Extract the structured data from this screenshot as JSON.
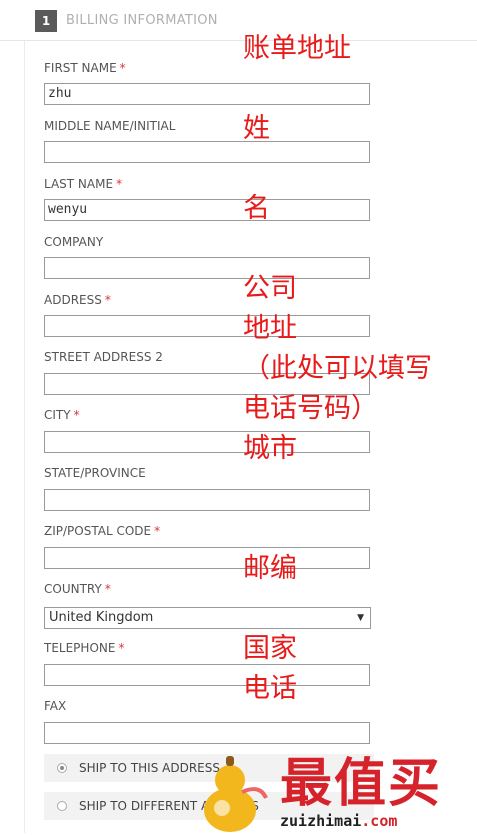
{
  "section": {
    "number": "1",
    "title": "BILLING INFORMATION"
  },
  "fields": {
    "first_name": {
      "label": "FIRST NAME",
      "required": "*",
      "value": "zhu"
    },
    "middle_name": {
      "label": "MIDDLE NAME/INITIAL",
      "value": ""
    },
    "last_name": {
      "label": "LAST NAME",
      "required": "*",
      "value": "wenyu"
    },
    "company": {
      "label": "COMPANY",
      "value": ""
    },
    "address": {
      "label": "ADDRESS",
      "required": "*",
      "value": ""
    },
    "street2": {
      "label": "STREET ADDRESS 2",
      "value": ""
    },
    "city": {
      "label": "CITY",
      "required": "*",
      "value": ""
    },
    "state": {
      "label": "STATE/PROVINCE",
      "value": ""
    },
    "zip": {
      "label": "ZIP/POSTAL CODE",
      "required": "*",
      "value": ""
    },
    "country": {
      "label": "COUNTRY",
      "required": "*",
      "value": "United Kingdom"
    },
    "telephone": {
      "label": "TELEPHONE",
      "required": "*",
      "value": ""
    },
    "fax": {
      "label": "FAX",
      "value": ""
    }
  },
  "shipping_options": [
    {
      "label": "SHIP TO THIS ADDRESS",
      "checked": true
    },
    {
      "label": "SHIP TO DIFFERENT ADDRESS",
      "checked": false
    }
  ],
  "annotations": {
    "billing": "账单地址",
    "first_name": "姓",
    "last_name": "名",
    "company": "公司",
    "address": "地址",
    "street2_line1": "（此处可以填写",
    "street2_line2": "电话号码）",
    "city": "城市",
    "zip": "邮编",
    "country": "国家",
    "telephone": "电话"
  },
  "watermark": {
    "brand": "最值买",
    "url_prefix": "zuizhimai",
    "url_suffix": ".com"
  },
  "colors": {
    "required": "#dd3333",
    "annotation": "#e81b1b",
    "watermark": "#d6232b"
  }
}
